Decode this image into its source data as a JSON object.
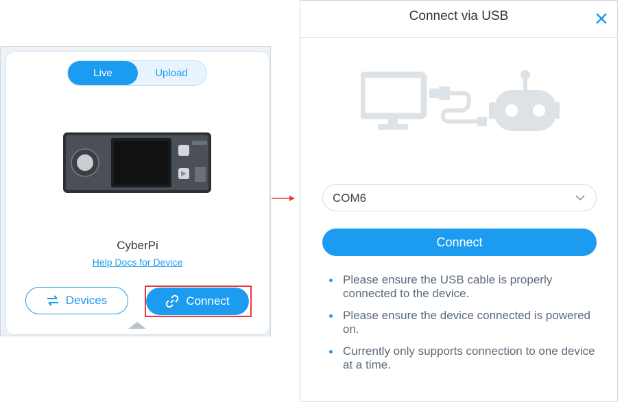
{
  "left_panel": {
    "mode_toggle": {
      "live": "Live",
      "upload": "Upload",
      "active": "Live"
    },
    "device_name": "CyberPi",
    "help_link": "Help Docs for Device",
    "devices_button": "Devices",
    "connect_button": "Connect",
    "icons": {
      "devices": "swap-arrows-icon",
      "connect": "link-icon"
    }
  },
  "dialog": {
    "title": "Connect via USB",
    "close_icon": "close-icon",
    "port_select": {
      "value": "COM6"
    },
    "connect_button": "Connect",
    "notes": [
      "Please ensure the USB cable is properly connected to the device.",
      "Please ensure the device connected is powered on.",
      "Currently only supports connection to one device at a time."
    ]
  },
  "colors": {
    "accent": "#1c9cf0",
    "highlight": "#e53935",
    "illustration": "#dde2e7",
    "note_text": "#5a6a7a"
  }
}
